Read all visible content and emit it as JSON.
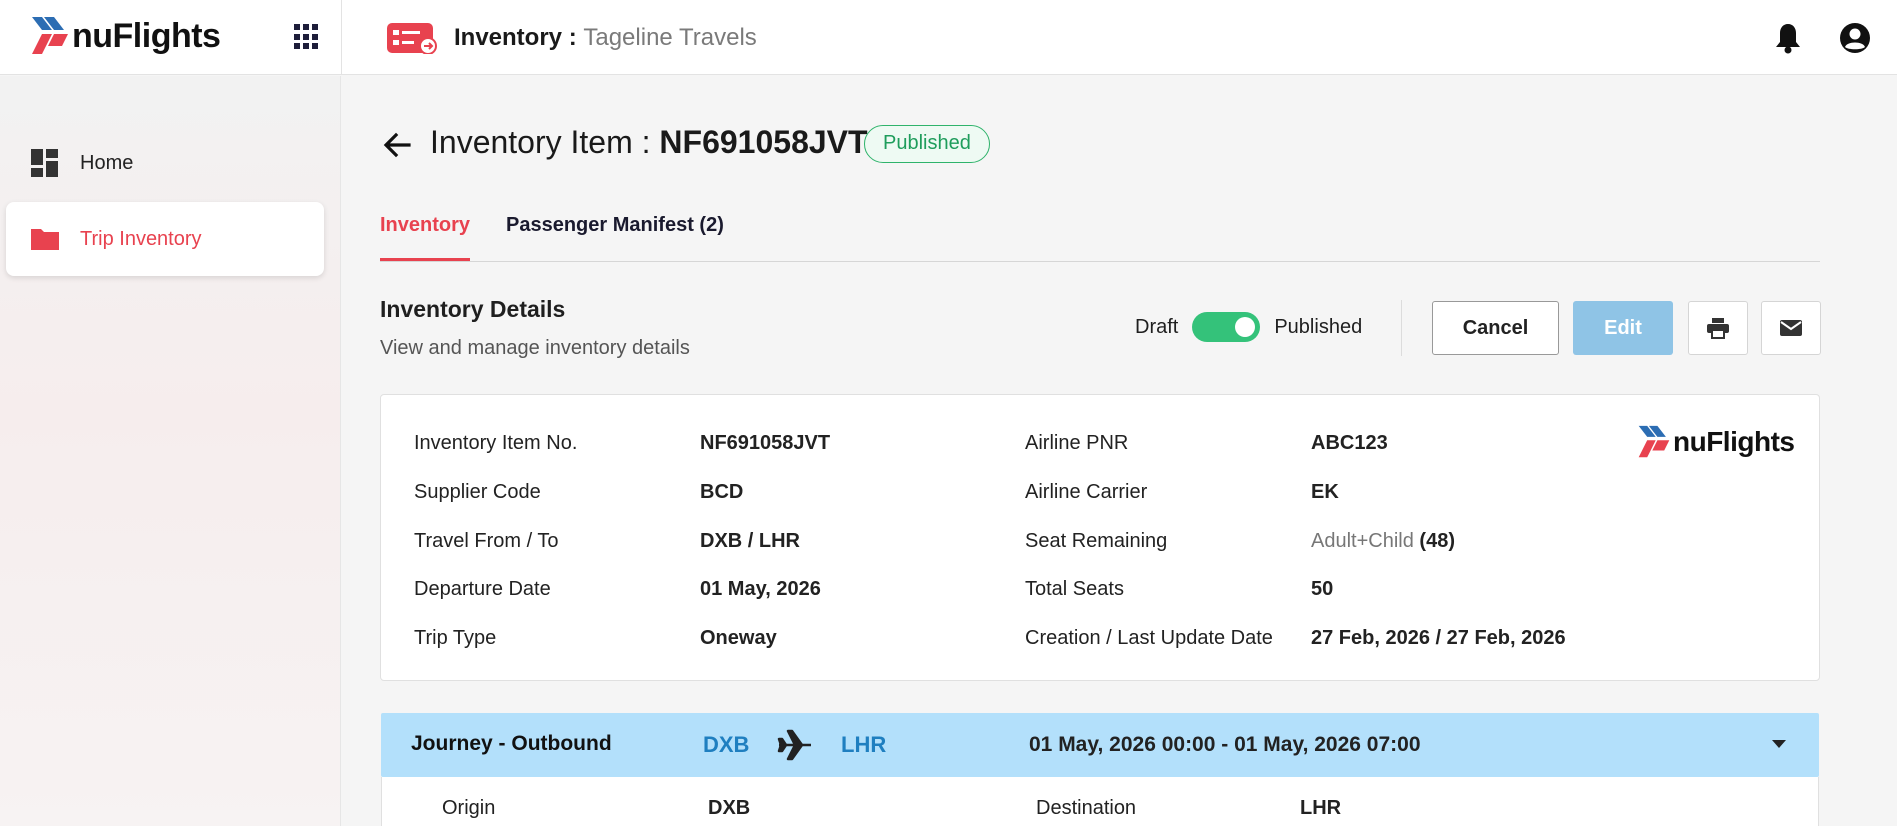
{
  "brand": {
    "name": "nuFlights"
  },
  "header": {
    "title": "Inventory :",
    "subtitle": "Tageline Travels"
  },
  "sidebar": {
    "items": [
      {
        "label": "Home"
      },
      {
        "label": "Trip Inventory"
      }
    ]
  },
  "item": {
    "title_prefix": "Inventory Item :",
    "code": "NF691058JVT",
    "status": "Published"
  },
  "tabs": [
    {
      "label": "Inventory"
    },
    {
      "label": "Passenger Manifest (2)"
    }
  ],
  "details": {
    "title": "Inventory Details",
    "subtitle": "View and manage inventory details",
    "toggle": {
      "off_label": "Draft",
      "on_label": "Published",
      "state": "Published"
    },
    "actions": {
      "cancel": "Cancel",
      "edit": "Edit"
    },
    "left": [
      {
        "label": "Inventory Item No.",
        "value": "NF691058JVT"
      },
      {
        "label": "Supplier Code",
        "value": "BCD"
      },
      {
        "label": "Travel From / To",
        "value": "DXB / LHR"
      },
      {
        "label": "Departure Date",
        "value": "01 May, 2026"
      },
      {
        "label": "Trip Type",
        "value": "Oneway"
      }
    ],
    "right": [
      {
        "label": "Airline PNR",
        "value": "ABC123"
      },
      {
        "label": "Airline Carrier",
        "value": "EK"
      },
      {
        "label": "Seat Remaining",
        "value_muted": "Adult+Child",
        "value": "(48)"
      },
      {
        "label": "Total Seats",
        "value": "50"
      },
      {
        "label": "Creation / Last Update Date",
        "value": "27 Feb, 2026 / 27 Feb, 2026"
      }
    ]
  },
  "journey": {
    "title": "Journey - Outbound",
    "from": "DXB",
    "to": "LHR",
    "dates": "01 May, 2026 00:00 - 01 May, 2026 07:00",
    "origin_label": "Origin",
    "origin_value": "DXB",
    "destination_label": "Destination",
    "destination_value": "LHR"
  },
  "colors": {
    "accent": "#e8424f",
    "published_green": "#2fb36b",
    "journey_bar": "#b3e0fb",
    "edit_button": "#8fc4e6",
    "link_blue": "#1f7fc0"
  }
}
